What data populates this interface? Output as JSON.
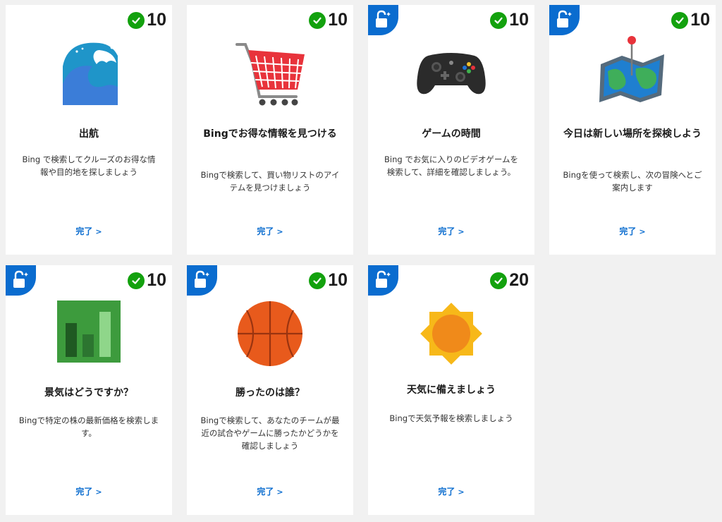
{
  "complete_label": "完了",
  "complete_chevron": ">",
  "cards": [
    {
      "title": "出航",
      "desc": "Bing で検索してクルーズのお得な情報や目的地を探しましょう",
      "points": "10",
      "locked": false,
      "icon": "wave-icon"
    },
    {
      "title": "Bingでお得な情報を見つける",
      "desc": "Bingで検索して、買い物リストのアイテムを見つけましょう",
      "points": "10",
      "locked": false,
      "icon": "shopping-cart-icon"
    },
    {
      "title": "ゲームの時間",
      "desc": "Bing でお気に入りのビデオゲームを検索して、詳細を確認しましょう。",
      "points": "10",
      "locked": true,
      "icon": "game-controller-icon"
    },
    {
      "title": "今日は新しい場所を探検しよう",
      "desc": "Bingを使って検索し、次の冒険へとご案内します",
      "points": "10",
      "locked": true,
      "icon": "map-pin-icon"
    },
    {
      "title": "景気はどうですか？",
      "desc": "Bingで特定の株の最新価格を検索します。",
      "points": "10",
      "locked": true,
      "icon": "bar-chart-icon"
    },
    {
      "title": "勝ったのは誰？",
      "desc": "Bingで検索して、あなたのチームが最近の試合やゲームに勝ったかどうかを確認しましょう",
      "points": "10",
      "locked": true,
      "icon": "basketball-icon"
    },
    {
      "title": "天気に備えましょう",
      "desc": "Bingで天気予報を検索しましょう",
      "points": "20",
      "locked": true,
      "icon": "sun-icon"
    }
  ]
}
